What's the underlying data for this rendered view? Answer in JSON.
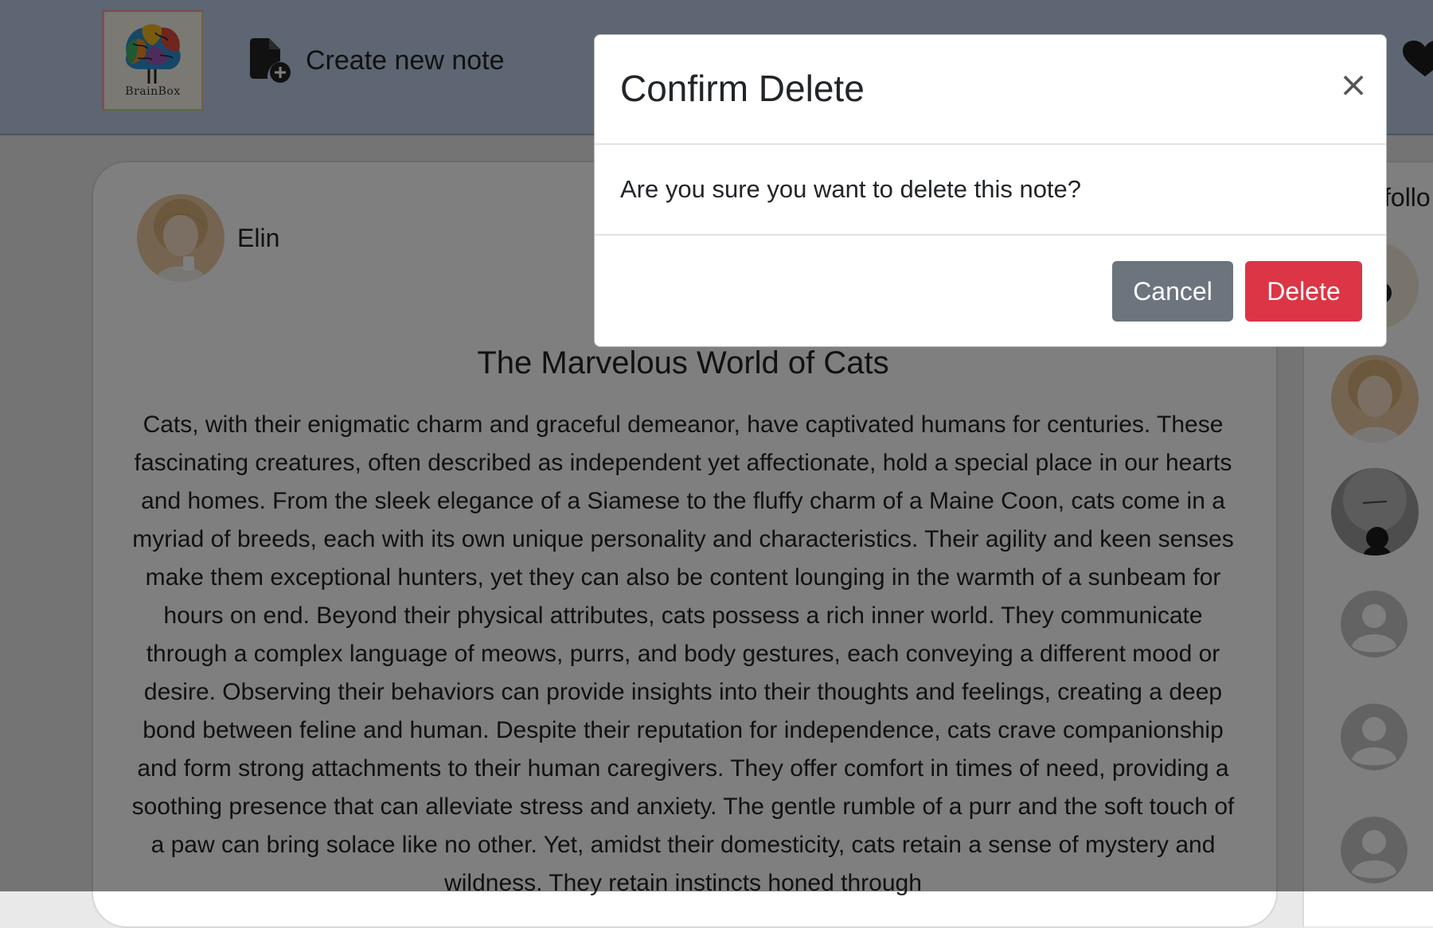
{
  "header": {
    "logo_text": "BrainBox",
    "create_note_label": "Create new note"
  },
  "note": {
    "author": "Elin",
    "title": "The Marvelous World of Cats",
    "body": "Cats, with their enigmatic charm and graceful demeanor, have captivated humans for centuries. These fascinating creatures, often described as independent yet affectionate, hold a special place in our hearts and homes. From the sleek elegance of a Siamese to the fluffy charm of a Maine Coon, cats come in a myriad of breeds, each with its own unique personality and characteristics. Their agility and keen senses make them exceptional hunters, yet they can also be content lounging in the warmth of a sunbeam for hours on end. Beyond their physical attributes, cats possess a rich inner world. They communicate through a complex language of meows, purrs, and body gestures, each conveying a different mood or desire. Observing their behaviors can provide insights into their thoughts and feelings, creating a deep bond between feline and human. Despite their reputation for independence, cats crave companionship and form strong attachments to their human caregivers. They offer comfort in times of need, providing a soothing presence that can alleviate stress and anxiety. The gentle rumble of a purr and the soft touch of a paw can bring solace like no other. Yet, amidst their domesticity, cats retain a sense of mystery and wildness. They retain instincts honed through"
  },
  "sidebar": {
    "follow_label": "follo"
  },
  "modal": {
    "title": "Confirm Delete",
    "message": "Are you sure you want to delete this note?",
    "close_symbol": "×",
    "cancel_label": "Cancel",
    "delete_label": "Delete"
  },
  "colors": {
    "cancel_button": "#6c757d",
    "delete_button": "#dc3545",
    "header_bg": "#bccde6"
  }
}
